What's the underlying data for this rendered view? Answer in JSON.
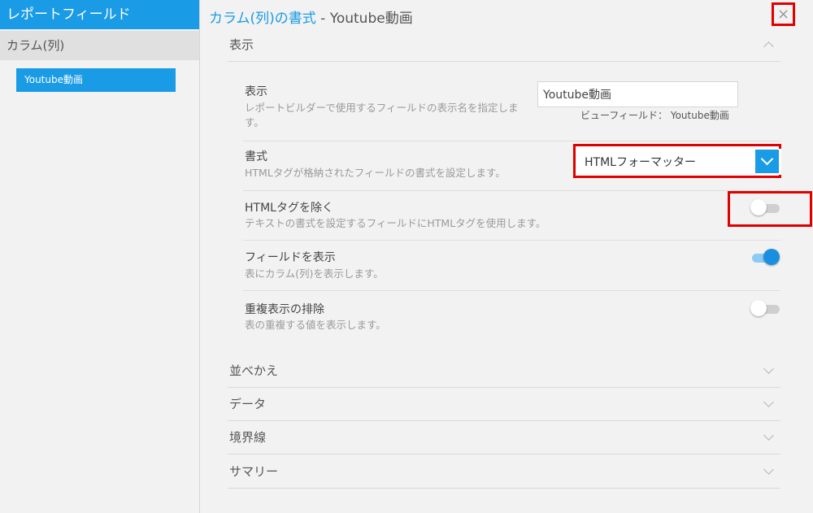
{
  "sidebar": {
    "title": "レポートフィールド",
    "section": "カラム(列)",
    "items": [
      {
        "label": "Youtube動画"
      }
    ]
  },
  "header": {
    "title_accent": "カラム(列)の書式",
    "title_rest": " - Youtube動画",
    "close_icon": "×"
  },
  "display_section": {
    "label": "表示",
    "rows": {
      "display_name": {
        "label": "表示",
        "desc_line1": "レポートビルダーで使用するフィールドの表示名を指定しま",
        "desc_line2": "す。",
        "value": "Youtube動画",
        "view_field_note": "ビューフィールド： Youtube動画"
      },
      "format": {
        "label": "書式",
        "desc": "HTMLタグが格納されたフィールドの書式を設定します。",
        "selected": "HTMLフォーマッター"
      },
      "strip_html": {
        "label": "HTMLタグを除く",
        "desc": "テキストの書式を設定するフィールドにHTMLタグを使用します。",
        "enabled": false
      },
      "show_field": {
        "label": "フィールドを表示",
        "desc": "表にカラム(列)を表示します。",
        "enabled": true
      },
      "dedupe": {
        "label": "重複表示の排除",
        "desc": "表の重複する値を表示します。",
        "enabled": false
      }
    }
  },
  "sections": [
    {
      "label": "並べかえ"
    },
    {
      "label": "データ"
    },
    {
      "label": "境界線"
    },
    {
      "label": "サマリー"
    }
  ],
  "colors": {
    "accent": "#1a9be6",
    "highlight_outline": "#e00000"
  }
}
